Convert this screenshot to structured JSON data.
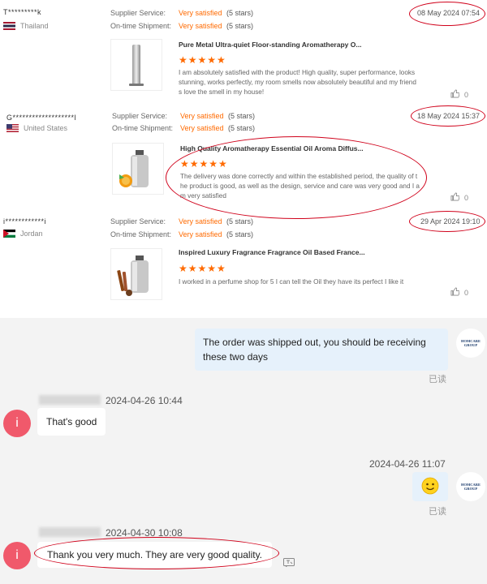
{
  "reviews": [
    {
      "name": "T*********k",
      "country": "Thailand",
      "supplier_label": "Supplier Service:",
      "supplier_value": "Very satisfied",
      "supplier_stars": "(5 stars)",
      "shipment_label": "On-time Shipment:",
      "shipment_value": "Very satisfied",
      "shipment_stars": "(5 stars)",
      "date": "08 May 2024 07:54",
      "product_title": "Pure Metal Ultra-quiet Floor-standing Aromatherapy O...",
      "stars": "★★★★★",
      "text": "I am absolutely satisfied with the product! High quality, super performance, looks stunning, works perfectly, my room smells now absolutely beautiful and my friends love the smell in my house!",
      "likes": "0"
    },
    {
      "name": "G*******************l",
      "country": "United States",
      "supplier_label": "Supplier Service:",
      "supplier_value": "Very satisfied",
      "supplier_stars": "(5 stars)",
      "shipment_label": "On-time Shipment:",
      "shipment_value": "Very satisfied",
      "shipment_stars": "(5 stars)",
      "date": "18 May 2024 15:37",
      "product_title": "High Quality Aromatherapy Essential Oil Aroma Diffus...",
      "stars": "★★★★★",
      "text": "The delivery was done correctly and within the established period, the quality of the product is good, as well as the design, service and care was very good and I am very satisfied",
      "likes": "0"
    },
    {
      "name": "i************i",
      "country": "Jordan",
      "supplier_label": "Supplier Service:",
      "supplier_value": "Very satisfied",
      "supplier_stars": "(5 stars)",
      "shipment_label": "On-time Shipment:",
      "shipment_value": "Very satisfied",
      "shipment_stars": "(5 stars)",
      "date": "29 Apr 2024 19:10",
      "product_title": "Inspired Luxury Fragrance Fragrance Oil Based France...",
      "stars": "★★★★★",
      "text": "I worked in a perfume shop for 5 I can tell the Oil they have its perfect I like it",
      "likes": "0"
    }
  ],
  "chat": {
    "msg1": "The order was shipped out, you should be receiving these two days",
    "read1": "已读",
    "ts2": "2024-04-26 10:44",
    "msg2": "That's good",
    "ts3": "2024-04-26 11:07",
    "read3": "已读",
    "ts4": "2024-04-30 10:08",
    "msg4": "Thank you very much. They are very good quality.",
    "avatar_letter": "i",
    "logo_line1": "HOMCARE",
    "logo_line2": "GROUP"
  },
  "colors": {
    "accent": "#ff6a00",
    "annotation": "#d0021b",
    "avatar": "#f0596b",
    "mine_bubble": "#e6f1fb"
  }
}
